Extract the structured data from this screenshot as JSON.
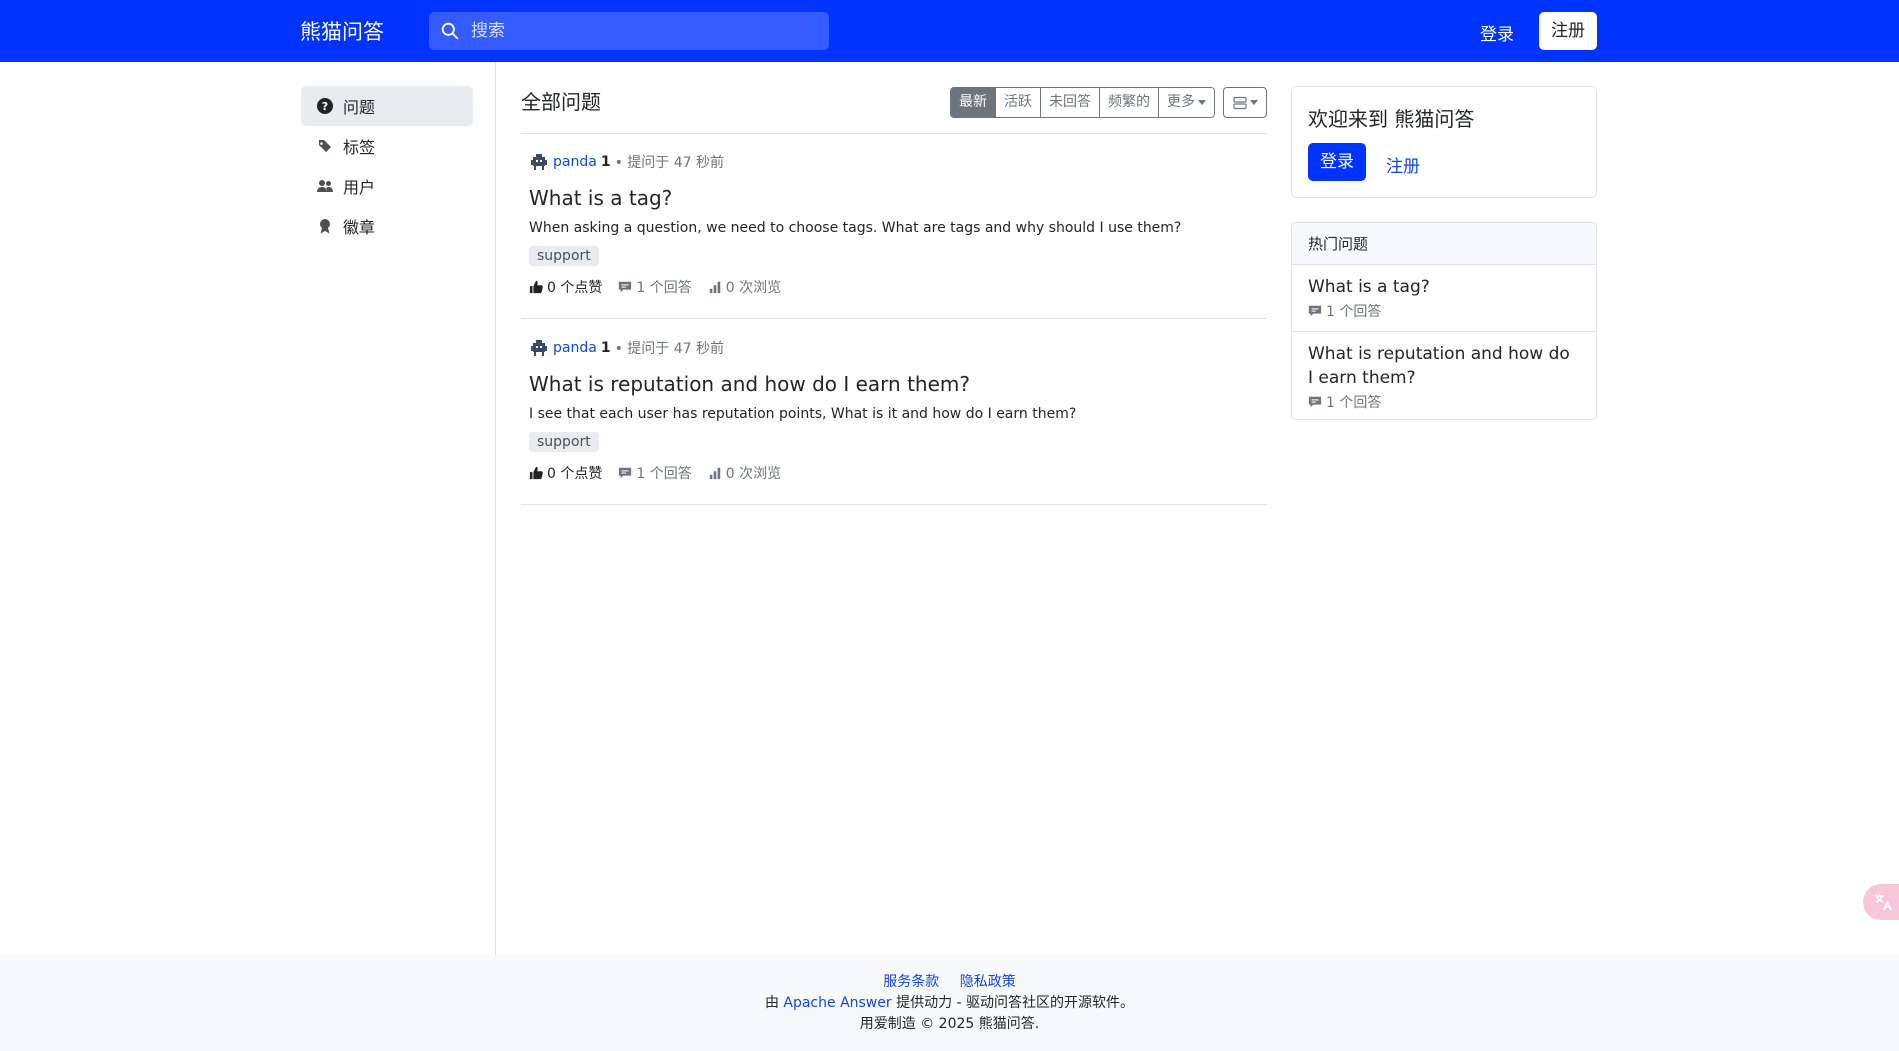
{
  "header": {
    "brand": "熊猫问答",
    "search_placeholder": "搜索",
    "login": "登录",
    "signup": "注册",
    "bg_color": "#0033ff"
  },
  "sidebar": {
    "items": [
      {
        "label": "问题",
        "icon": "question-circle-icon",
        "active": true
      },
      {
        "label": "标签",
        "icon": "tags-icon",
        "active": false
      },
      {
        "label": "用户",
        "icon": "users-icon",
        "active": false
      },
      {
        "label": "徽章",
        "icon": "award-icon",
        "active": false
      }
    ]
  },
  "main": {
    "title": "全部问题",
    "filters": [
      {
        "label": "最新",
        "active": true
      },
      {
        "label": "活跃",
        "active": false
      },
      {
        "label": "未回答",
        "active": false
      },
      {
        "label": "频繁的",
        "active": false
      },
      {
        "label": "更多",
        "active": false
      }
    ],
    "questions": [
      {
        "user": "panda",
        "reputation": "1",
        "asked": "• 提问于 47 秒前",
        "title": "What is a tag?",
        "excerpt": "When asking a question, we need to choose tags. What are tags and why should I use them?",
        "tag": "support",
        "votes": "0 个点赞",
        "answers": "1 个回答",
        "views": "0 次浏览"
      },
      {
        "user": "panda",
        "reputation": "1",
        "asked": "• 提问于 47 秒前",
        "title": "What is reputation and how do I earn them?",
        "excerpt": "I see that each user has reputation points, What is it and how do I earn them?",
        "tag": "support",
        "votes": "0 个点赞",
        "answers": "1 个回答",
        "views": "0 次浏览"
      }
    ]
  },
  "welcome": {
    "title": "欢迎来到 熊猫问答",
    "login": "登录",
    "signup": "注册"
  },
  "hot": {
    "title": "热门问题",
    "items": [
      {
        "title": "What is a tag?",
        "answers": "1 个回答"
      },
      {
        "title": "What is reputation and how do I earn them?",
        "answers": "1 个回答"
      }
    ]
  },
  "footer": {
    "terms": "服务条款",
    "privacy": "隐私政策",
    "powered_prefix": "由 ",
    "powered_link": "Apache Answer",
    "powered_suffix": " 提供动力 - 驱动问答社区的开源软件。",
    "copyright": "用爱制造 © 2025 熊猫问答."
  }
}
